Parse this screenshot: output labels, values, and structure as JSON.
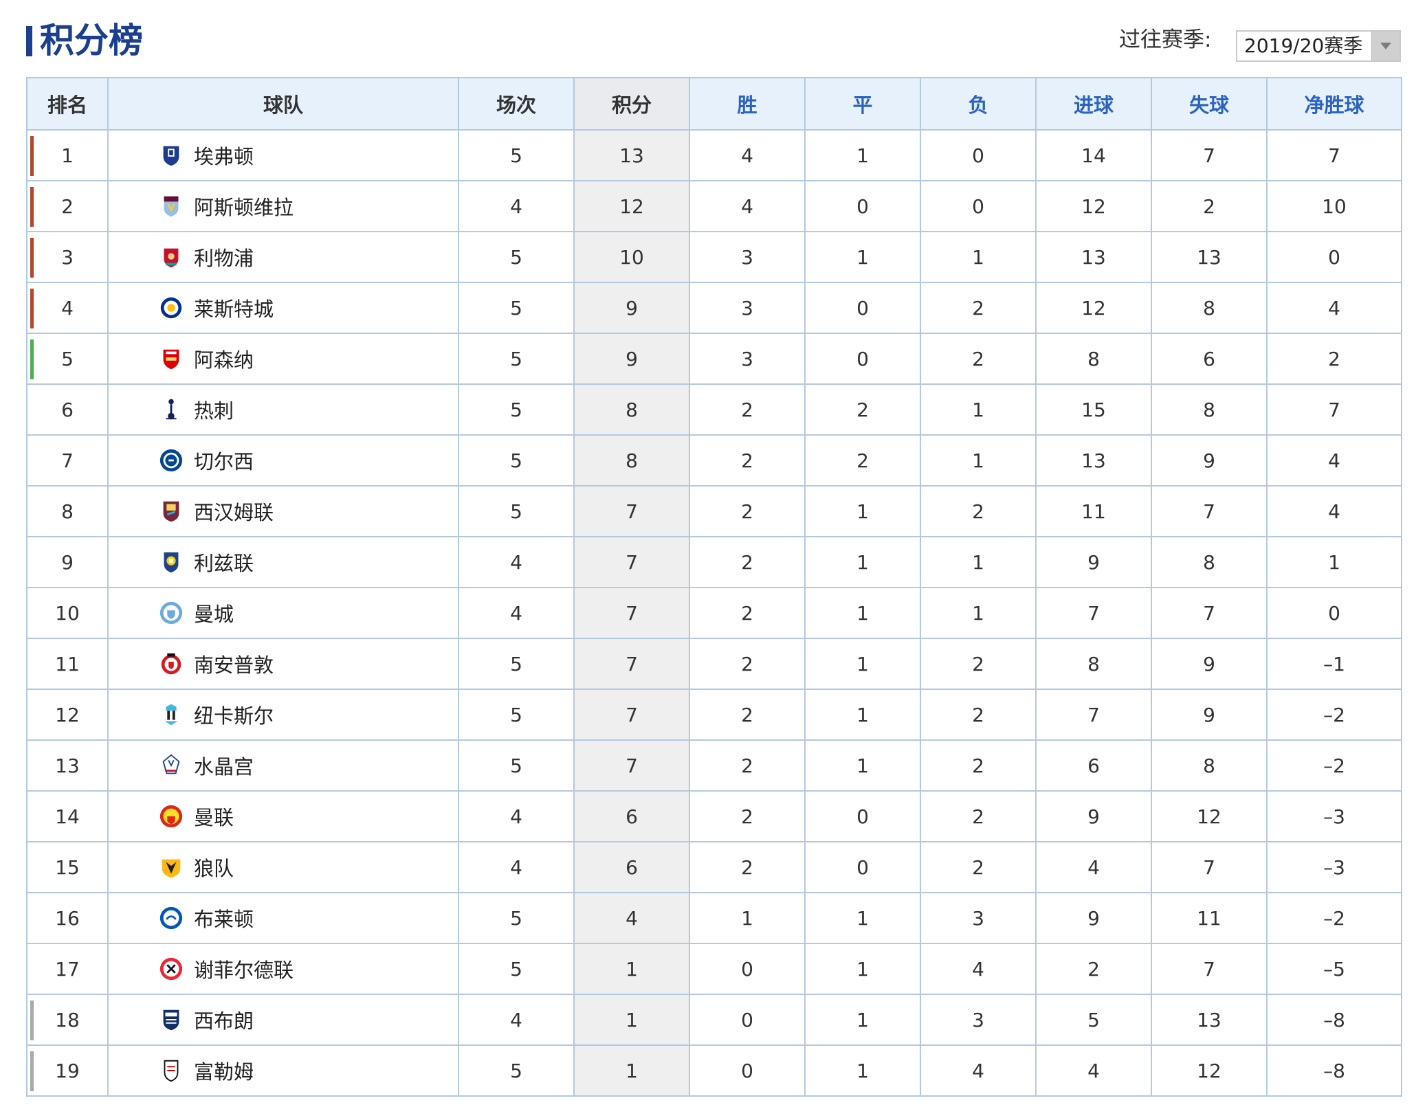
{
  "header": {
    "title": "积分榜",
    "season_label": "过往赛季:",
    "season_selected": "2019/20赛季"
  },
  "colors": {
    "title_blue": "#1b3f8f",
    "zone_champions": "#b5462a",
    "zone_europa": "#4caf50",
    "zone_relegation": "#a9a9a9"
  },
  "table": {
    "headers": [
      "排名",
      "球队",
      "场次",
      "积分",
      "胜",
      "平",
      "负",
      "进球",
      "失球",
      "净胜球"
    ],
    "rows": [
      {
        "rank": "1",
        "team": "埃弗顿",
        "crest": "everton-crest-icon",
        "played": "5",
        "pts": "13",
        "w": "4",
        "d": "1",
        "l": "0",
        "gf": "14",
        "ga": "7",
        "gd": "7",
        "zone": "zone_champions"
      },
      {
        "rank": "2",
        "team": "阿斯顿维拉",
        "crest": "aston-villa-crest-icon",
        "played": "4",
        "pts": "12",
        "w": "4",
        "d": "0",
        "l": "0",
        "gf": "12",
        "ga": "2",
        "gd": "10",
        "zone": "zone_champions"
      },
      {
        "rank": "3",
        "team": "利物浦",
        "crest": "liverpool-crest-icon",
        "played": "5",
        "pts": "10",
        "w": "3",
        "d": "1",
        "l": "1",
        "gf": "13",
        "ga": "13",
        "gd": "0",
        "zone": "zone_champions"
      },
      {
        "rank": "4",
        "team": "莱斯特城",
        "crest": "leicester-crest-icon",
        "played": "5",
        "pts": "9",
        "w": "3",
        "d": "0",
        "l": "2",
        "gf": "12",
        "ga": "8",
        "gd": "4",
        "zone": "zone_champions"
      },
      {
        "rank": "5",
        "team": "阿森纳",
        "crest": "arsenal-crest-icon",
        "played": "5",
        "pts": "9",
        "w": "3",
        "d": "0",
        "l": "2",
        "gf": "8",
        "ga": "6",
        "gd": "2",
        "zone": "zone_europa"
      },
      {
        "rank": "6",
        "team": "热刺",
        "crest": "tottenham-crest-icon",
        "played": "5",
        "pts": "8",
        "w": "2",
        "d": "2",
        "l": "1",
        "gf": "15",
        "ga": "8",
        "gd": "7",
        "zone": ""
      },
      {
        "rank": "7",
        "team": "切尔西",
        "crest": "chelsea-crest-icon",
        "played": "5",
        "pts": "8",
        "w": "2",
        "d": "2",
        "l": "1",
        "gf": "13",
        "ga": "9",
        "gd": "4",
        "zone": ""
      },
      {
        "rank": "8",
        "team": "西汉姆联",
        "crest": "west-ham-crest-icon",
        "played": "5",
        "pts": "7",
        "w": "2",
        "d": "1",
        "l": "2",
        "gf": "11",
        "ga": "7",
        "gd": "4",
        "zone": ""
      },
      {
        "rank": "9",
        "team": "利兹联",
        "crest": "leeds-crest-icon",
        "played": "4",
        "pts": "7",
        "w": "2",
        "d": "1",
        "l": "1",
        "gf": "9",
        "ga": "8",
        "gd": "1",
        "zone": ""
      },
      {
        "rank": "10",
        "team": "曼城",
        "crest": "man-city-crest-icon",
        "played": "4",
        "pts": "7",
        "w": "2",
        "d": "1",
        "l": "1",
        "gf": "7",
        "ga": "7",
        "gd": "0",
        "zone": ""
      },
      {
        "rank": "11",
        "team": "南安普敦",
        "crest": "southampton-crest-icon",
        "played": "5",
        "pts": "7",
        "w": "2",
        "d": "1",
        "l": "2",
        "gf": "8",
        "ga": "9",
        "gd": "–1",
        "zone": ""
      },
      {
        "rank": "12",
        "team": "纽卡斯尔",
        "crest": "newcastle-crest-icon",
        "played": "5",
        "pts": "7",
        "w": "2",
        "d": "1",
        "l": "2",
        "gf": "7",
        "ga": "9",
        "gd": "–2",
        "zone": ""
      },
      {
        "rank": "13",
        "team": "水晶宫",
        "crest": "crystal-palace-crest-icon",
        "played": "5",
        "pts": "7",
        "w": "2",
        "d": "1",
        "l": "2",
        "gf": "6",
        "ga": "8",
        "gd": "–2",
        "zone": ""
      },
      {
        "rank": "14",
        "team": "曼联",
        "crest": "man-united-crest-icon",
        "played": "4",
        "pts": "6",
        "w": "2",
        "d": "0",
        "l": "2",
        "gf": "9",
        "ga": "12",
        "gd": "–3",
        "zone": ""
      },
      {
        "rank": "15",
        "team": "狼队",
        "crest": "wolves-crest-icon",
        "played": "4",
        "pts": "6",
        "w": "2",
        "d": "0",
        "l": "2",
        "gf": "4",
        "ga": "7",
        "gd": "–3",
        "zone": ""
      },
      {
        "rank": "16",
        "team": "布莱顿",
        "crest": "brighton-crest-icon",
        "played": "5",
        "pts": "4",
        "w": "1",
        "d": "1",
        "l": "3",
        "gf": "9",
        "ga": "11",
        "gd": "–2",
        "zone": ""
      },
      {
        "rank": "17",
        "team": "谢菲尔德联",
        "crest": "sheffield-united-crest-icon",
        "played": "5",
        "pts": "1",
        "w": "0",
        "d": "1",
        "l": "4",
        "gf": "2",
        "ga": "7",
        "gd": "–5",
        "zone": ""
      },
      {
        "rank": "18",
        "team": "西布朗",
        "crest": "west-brom-crest-icon",
        "played": "4",
        "pts": "1",
        "w": "0",
        "d": "1",
        "l": "3",
        "gf": "5",
        "ga": "13",
        "gd": "–8",
        "zone": "zone_relegation"
      },
      {
        "rank": "19",
        "team": "富勒姆",
        "crest": "fulham-crest-icon",
        "played": "5",
        "pts": "1",
        "w": "0",
        "d": "1",
        "l": "4",
        "gf": "4",
        "ga": "12",
        "gd": "–8",
        "zone": "zone_relegation"
      }
    ]
  }
}
